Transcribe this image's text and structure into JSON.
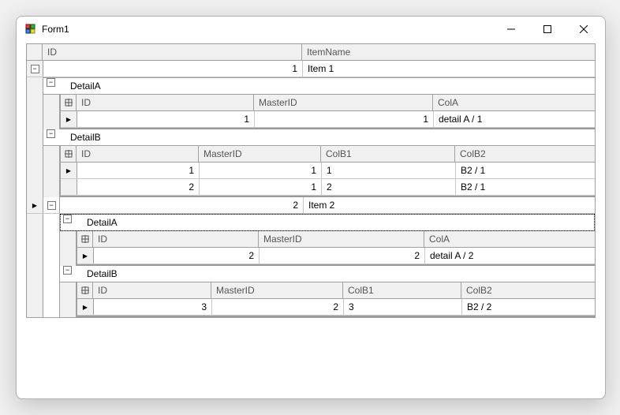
{
  "window": {
    "title": "Form1"
  },
  "master": {
    "columns": {
      "id": "ID",
      "itemName": "ItemName"
    },
    "rows": [
      {
        "id": "1",
        "itemName": "Item 1",
        "expanded": true,
        "detailA": {
          "title": "DetailA",
          "columns": {
            "id": "ID",
            "masterId": "MasterID",
            "colA": "ColA"
          },
          "rows": [
            {
              "id": "1",
              "masterId": "1",
              "colA": "detail A / 1"
            }
          ]
        },
        "detailB": {
          "title": "DetailB",
          "columns": {
            "id": "ID",
            "masterId": "MasterID",
            "colB1": "ColB1",
            "colB2": "ColB2"
          },
          "rows": [
            {
              "id": "1",
              "masterId": "1",
              "colB1": "1",
              "colB2": "B2 / 1"
            },
            {
              "id": "2",
              "masterId": "1",
              "colB1": "2",
              "colB2": "B2 / 1"
            }
          ]
        }
      },
      {
        "id": "2",
        "itemName": "Item 2",
        "expanded": true,
        "current": true,
        "detailA": {
          "title": "DetailA",
          "columns": {
            "id": "ID",
            "masterId": "MasterID",
            "colA": "ColA"
          },
          "rows": [
            {
              "id": "2",
              "masterId": "2",
              "colA": "detail A / 2"
            }
          ]
        },
        "detailB": {
          "title": "DetailB",
          "columns": {
            "id": "ID",
            "masterId": "MasterID",
            "colB1": "ColB1",
            "colB2": "ColB2"
          },
          "rows": [
            {
              "id": "3",
              "masterId": "2",
              "colB1": "3",
              "colB2": "B2 / 2"
            }
          ]
        }
      }
    ]
  }
}
